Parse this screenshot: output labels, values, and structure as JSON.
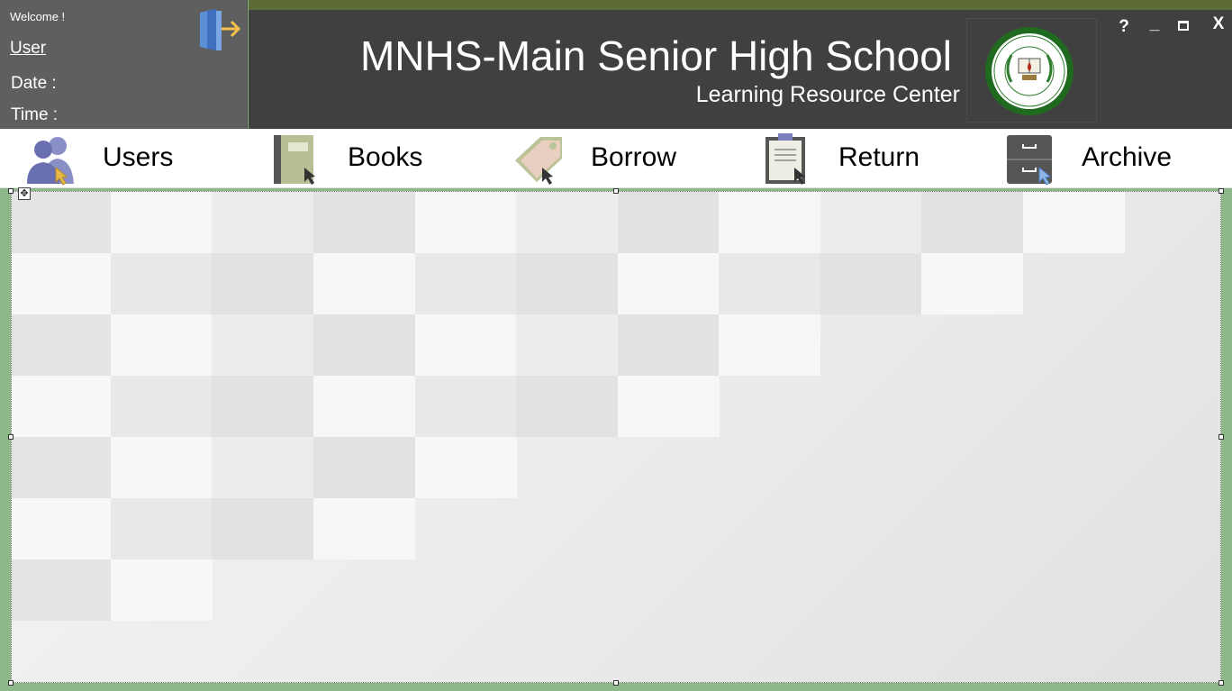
{
  "welcome": {
    "greeting": "Welcome !",
    "user": "User",
    "date_label": "Date :",
    "time_label": "Time :"
  },
  "header": {
    "school_name": "MNHS-Main Senior High School",
    "subtitle": "Learning Resource Center",
    "logo_icon": "school-seal-icon"
  },
  "window_controls": {
    "help": "?",
    "minimize": "_",
    "close": "X"
  },
  "nav": [
    {
      "label": "Users",
      "icon": "users-icon"
    },
    {
      "label": "Books",
      "icon": "book-icon"
    },
    {
      "label": "Borrow",
      "icon": "tag-icon"
    },
    {
      "label": "Return",
      "icon": "clipboard-icon"
    },
    {
      "label": "Archive",
      "icon": "cabinet-icon"
    }
  ],
  "colors": {
    "header_bg": "#404040",
    "panel_bg": "#5f5f5f",
    "accent_strip": "#5d6b37",
    "frame_green": "#8fb88a"
  }
}
